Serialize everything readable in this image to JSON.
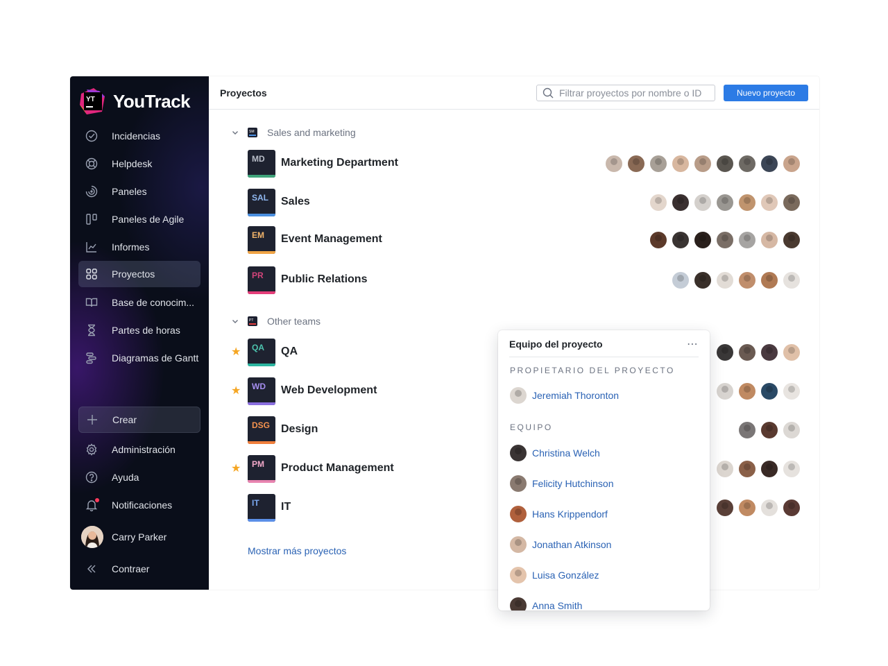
{
  "app": {
    "name": "YouTrack",
    "logo_letters": "YT"
  },
  "sidebar": {
    "items": [
      {
        "label": "Incidencias",
        "icon": "check-circle-icon"
      },
      {
        "label": "Helpdesk",
        "icon": "lifebuoy-icon"
      },
      {
        "label": "Paneles",
        "icon": "dashboard-icon"
      },
      {
        "label": "Paneles de Agile",
        "icon": "agile-board-icon"
      },
      {
        "label": "Informes",
        "icon": "chart-icon"
      },
      {
        "label": "Proyectos",
        "icon": "grid-icon",
        "active": true
      },
      {
        "label": "Base de conocim...",
        "icon": "book-icon"
      },
      {
        "label": "Partes de horas",
        "icon": "hourglass-icon"
      },
      {
        "label": "Diagramas de Gantt",
        "icon": "gantt-icon"
      }
    ],
    "create_label": "Crear",
    "bottom": [
      {
        "label": "Administración",
        "icon": "gear-icon"
      },
      {
        "label": "Ayuda",
        "icon": "help-icon"
      },
      {
        "label": "Notificaciones",
        "icon": "bell-icon"
      }
    ],
    "user": "Carry Parker",
    "collapse_label": "Contraer"
  },
  "header": {
    "title": "Proyectos",
    "search_placeholder": "Filtrar proyectos por nombre o ID",
    "new_project_label": "Nuevo proyecto"
  },
  "groups": [
    {
      "name": "Sales and marketing",
      "icon_text": "SM",
      "projects": [
        {
          "abbr": "MD",
          "name": "Marketing Department",
          "color": "#3fa37a",
          "starred": false,
          "members": 9
        },
        {
          "abbr": "SAL",
          "name": "Sales",
          "color": "#4a8fe0",
          "starred": false,
          "members": 7
        },
        {
          "abbr": "EM",
          "name": "Event Management",
          "color": "#f0a445",
          "starred": false,
          "members": 7
        },
        {
          "abbr": "PR",
          "name": "Public Relations",
          "color": "#e53e7a",
          "starred": false,
          "members": 6
        }
      ]
    },
    {
      "name": "Other teams",
      "icon_text": "PT",
      "projects": [
        {
          "abbr": "QA",
          "name": "QA",
          "color": "#2bb5a0",
          "starred": true,
          "members": 4
        },
        {
          "abbr": "WD",
          "name": "Web Development",
          "color": "#8b6fe0",
          "starred": true,
          "members": 4
        },
        {
          "abbr": "DSG",
          "name": "Design",
          "color": "#f07f3c",
          "starred": false,
          "members": 3
        },
        {
          "abbr": "PM",
          "name": "Product Management",
          "color": "#e884b0",
          "starred": true,
          "members": 4
        },
        {
          "abbr": "IT",
          "name": "IT",
          "color": "#5b8fe8",
          "starred": false,
          "members": 4
        }
      ]
    }
  ],
  "show_more_label": "Mostrar más proyectos",
  "popup": {
    "title": "Equipo del proyecto",
    "owner_label": "PROPIETARIO DEL PROYECTO",
    "owner": "Jeremiah Thoronton",
    "team_label": "EQUIPO",
    "team": [
      "Christina Welch",
      "Felicity Hutchinson",
      "Hans Krippendorf",
      "Jonathan Atkinson",
      "Luisa González",
      "Anna Smith"
    ]
  },
  "colors": {
    "accent": "#2c7be5",
    "link": "#2a62b4",
    "star": "#f5a623",
    "sidebar_bg": "#0a0e1a"
  }
}
